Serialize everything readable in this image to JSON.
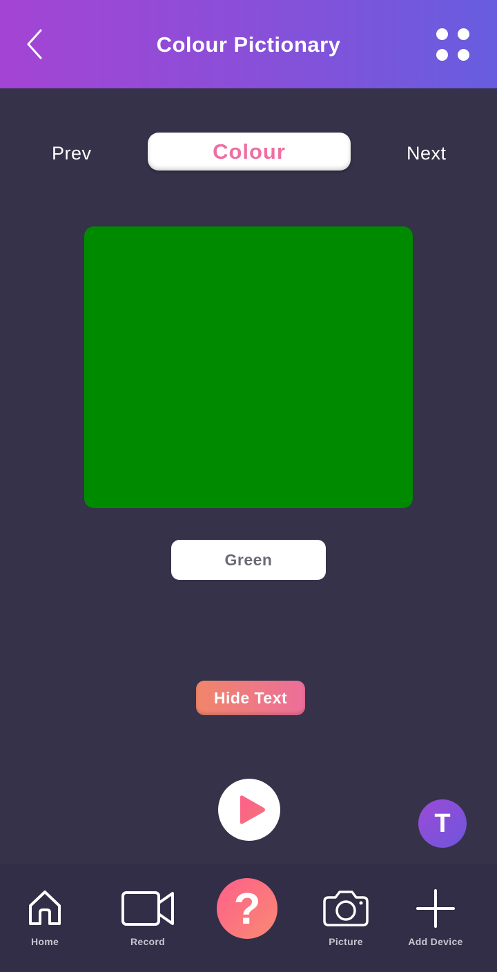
{
  "header": {
    "title": "Colour Pictionary",
    "back_icon": "chevron-left-icon",
    "menu_icon": "grid-dots-icon",
    "gradient": [
      "#a444d4",
      "#675ddf"
    ]
  },
  "nav": {
    "prev_label": "Prev",
    "next_label": "Next",
    "category_label": "Colour"
  },
  "card": {
    "colour": "#008a00",
    "name": "Green"
  },
  "controls": {
    "hide_text_label": "Hide Text",
    "play_icon": "play-icon"
  },
  "user": {
    "avatar_initial": "T"
  },
  "tabs": [
    {
      "label": "Home",
      "icon": "home-icon"
    },
    {
      "label": "Record",
      "icon": "video-camera-icon"
    },
    {
      "label": "",
      "icon": "question-mark-icon"
    },
    {
      "label": "Picture",
      "icon": "camera-icon"
    },
    {
      "label": "Add Device",
      "icon": "plus-icon"
    }
  ],
  "colors": {
    "background": "#35324a",
    "accent_pink": "#ee6fa3",
    "help_gradient": [
      "#ff5f8a",
      "#f88a73"
    ]
  }
}
